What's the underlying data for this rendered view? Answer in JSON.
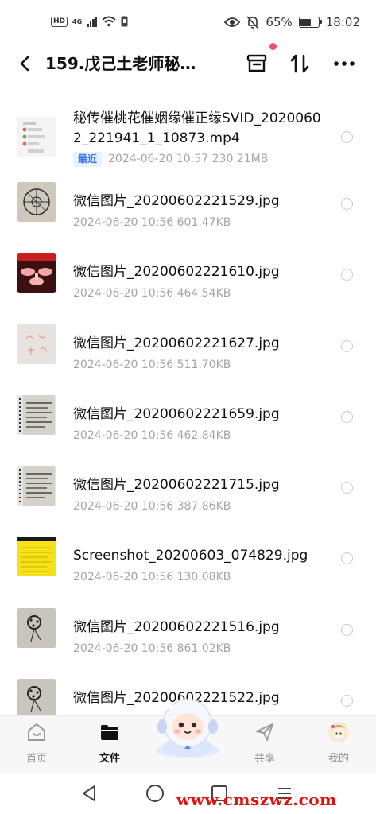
{
  "status_bar": {
    "hd": "HD",
    "network": "4G",
    "battery_text": "65%",
    "battery_level": 0.65,
    "time": "18:02"
  },
  "header": {
    "title": "159.戊己土老师秘…",
    "icons": [
      "back-icon",
      "archive-icon",
      "sort-icon",
      "more-icon"
    ]
  },
  "files": [
    {
      "name": "秘传催桃花催姻缘催正缘SVID_20200602_221941_1_10873.mp4",
      "badge": "最近",
      "date": "2024-06-20",
      "time": "10:57",
      "size": "230.21MB",
      "thumb": "chat-screenshot"
    },
    {
      "name": "微信图片_20200602221529.jpg",
      "badge": "",
      "date": "2024-06-20",
      "time": "10:56",
      "size": "601.47KB",
      "thumb": "circle-diagram"
    },
    {
      "name": "微信图片_20200602221610.jpg",
      "badge": "",
      "date": "2024-06-20",
      "time": "10:56",
      "size": "464.54KB",
      "thumb": "red-cups"
    },
    {
      "name": "微信图片_20200602221627.jpg",
      "badge": "",
      "date": "2024-06-20",
      "time": "10:56",
      "size": "511.70KB",
      "thumb": "pink-paper"
    },
    {
      "name": "微信图片_20200602221659.jpg",
      "badge": "",
      "date": "2024-06-20",
      "time": "10:56",
      "size": "462.84KB",
      "thumb": "notebook"
    },
    {
      "name": "微信图片_20200602221715.jpg",
      "badge": "",
      "date": "2024-06-20",
      "time": "10:56",
      "size": "387.86KB",
      "thumb": "notebook"
    },
    {
      "name": "Screenshot_20200603_074829.jpg",
      "badge": "",
      "date": "2024-06-20",
      "time": "10:56",
      "size": "130.08KB",
      "thumb": "yellow-doc"
    },
    {
      "name": "微信图片_20200602221516.jpg",
      "badge": "",
      "date": "2024-06-20",
      "time": "10:56",
      "size": "861.02KB",
      "thumb": "sketch"
    },
    {
      "name": "微信图片_20200602221522.jpg",
      "badge": "",
      "date": "",
      "time": "",
      "size": "",
      "thumb": "sketch"
    }
  ],
  "tabs": [
    {
      "label": "首页",
      "icon": "home-icon",
      "active": false
    },
    {
      "label": "文件",
      "icon": "folder-icon",
      "active": true
    },
    {
      "label": "共享",
      "icon": "share-icon",
      "active": false
    },
    {
      "label": "我的",
      "icon": "avatar-icon",
      "active": false
    }
  ],
  "nav": {
    "icons": [
      "back-triangle-icon",
      "home-circle-icon",
      "recents-square-icon",
      "menu-icon"
    ]
  },
  "watermark": "www.cmszwz.com",
  "colors": {
    "accent": "#3a74f2",
    "badge_bg": "#e8f1fe",
    "notify_dot": "#f0506e",
    "watermark": "#e01010"
  }
}
